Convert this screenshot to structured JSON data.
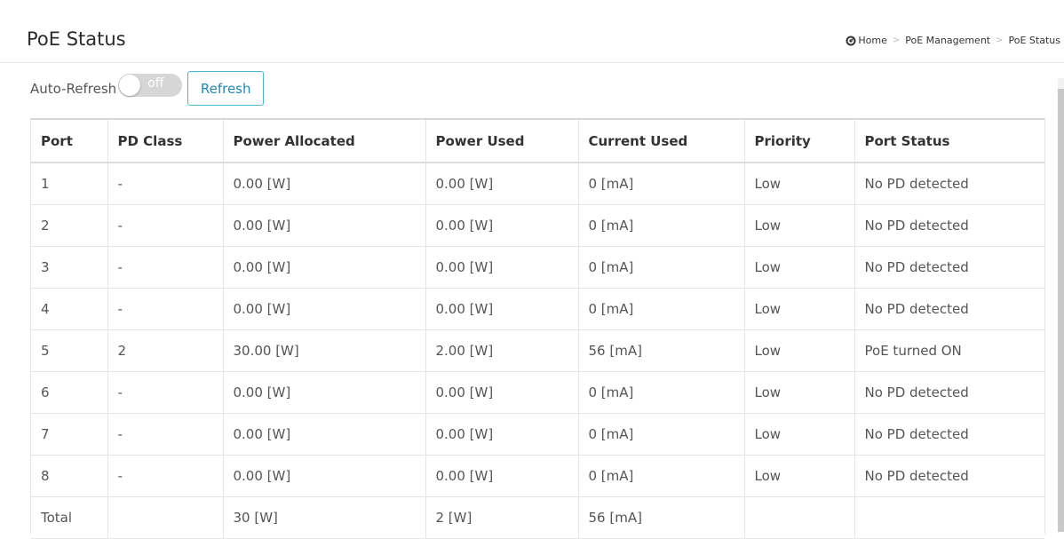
{
  "header": {
    "title": "PoE Status",
    "breadcrumb": [
      "Home",
      "PoE Management",
      "PoE Status"
    ]
  },
  "toolbar": {
    "auto_refresh_label": "Auto-Refresh",
    "toggle_state": "off",
    "refresh_label": "Refresh"
  },
  "table": {
    "columns": [
      "Port",
      "PD Class",
      "Power Allocated",
      "Power Used",
      "Current Used",
      "Priority",
      "Port Status"
    ],
    "rows": [
      [
        "1",
        "-",
        "0.00 [W]",
        "0.00 [W]",
        "0 [mA]",
        "Low",
        "No PD detected"
      ],
      [
        "2",
        "-",
        "0.00 [W]",
        "0.00 [W]",
        "0 [mA]",
        "Low",
        "No PD detected"
      ],
      [
        "3",
        "-",
        "0.00 [W]",
        "0.00 [W]",
        "0 [mA]",
        "Low",
        "No PD detected"
      ],
      [
        "4",
        "-",
        "0.00 [W]",
        "0.00 [W]",
        "0 [mA]",
        "Low",
        "No PD detected"
      ],
      [
        "5",
        "2",
        "30.00 [W]",
        "2.00 [W]",
        "56 [mA]",
        "Low",
        "PoE turned ON"
      ],
      [
        "6",
        "-",
        "0.00 [W]",
        "0.00 [W]",
        "0 [mA]",
        "Low",
        "No PD detected"
      ],
      [
        "7",
        "-",
        "0.00 [W]",
        "0.00 [W]",
        "0 [mA]",
        "Low",
        "No PD detected"
      ],
      [
        "8",
        "-",
        "0.00 [W]",
        "0.00 [W]",
        "0 [mA]",
        "Low",
        "No PD detected"
      ],
      [
        "Total",
        "",
        "30 [W]",
        "2 [W]",
        "56 [mA]",
        "",
        ""
      ]
    ]
  }
}
